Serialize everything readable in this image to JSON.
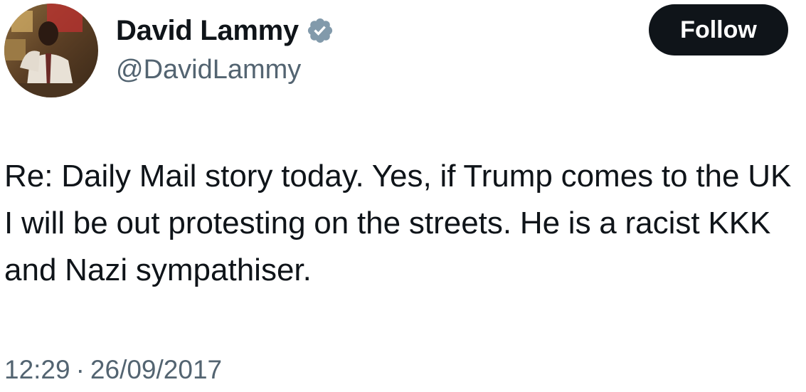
{
  "author": {
    "display_name": "David Lammy",
    "handle": "@DavidLammy",
    "verified_icon": "verified-badge-icon",
    "verified_color": "#829aab"
  },
  "follow_button": {
    "label": "Follow",
    "background": "#0f1419",
    "text_color": "#ffffff"
  },
  "tweet": {
    "text": "Re: Daily Mail story today. Yes, if Trump comes to the UK I will be out protesting on the streets. He is a racist KKK and Nazi sympathiser.",
    "time": "12:29",
    "separator": "·",
    "date": "26/09/2017"
  },
  "colors": {
    "primary_text": "#0f1419",
    "secondary_text": "#536471"
  }
}
